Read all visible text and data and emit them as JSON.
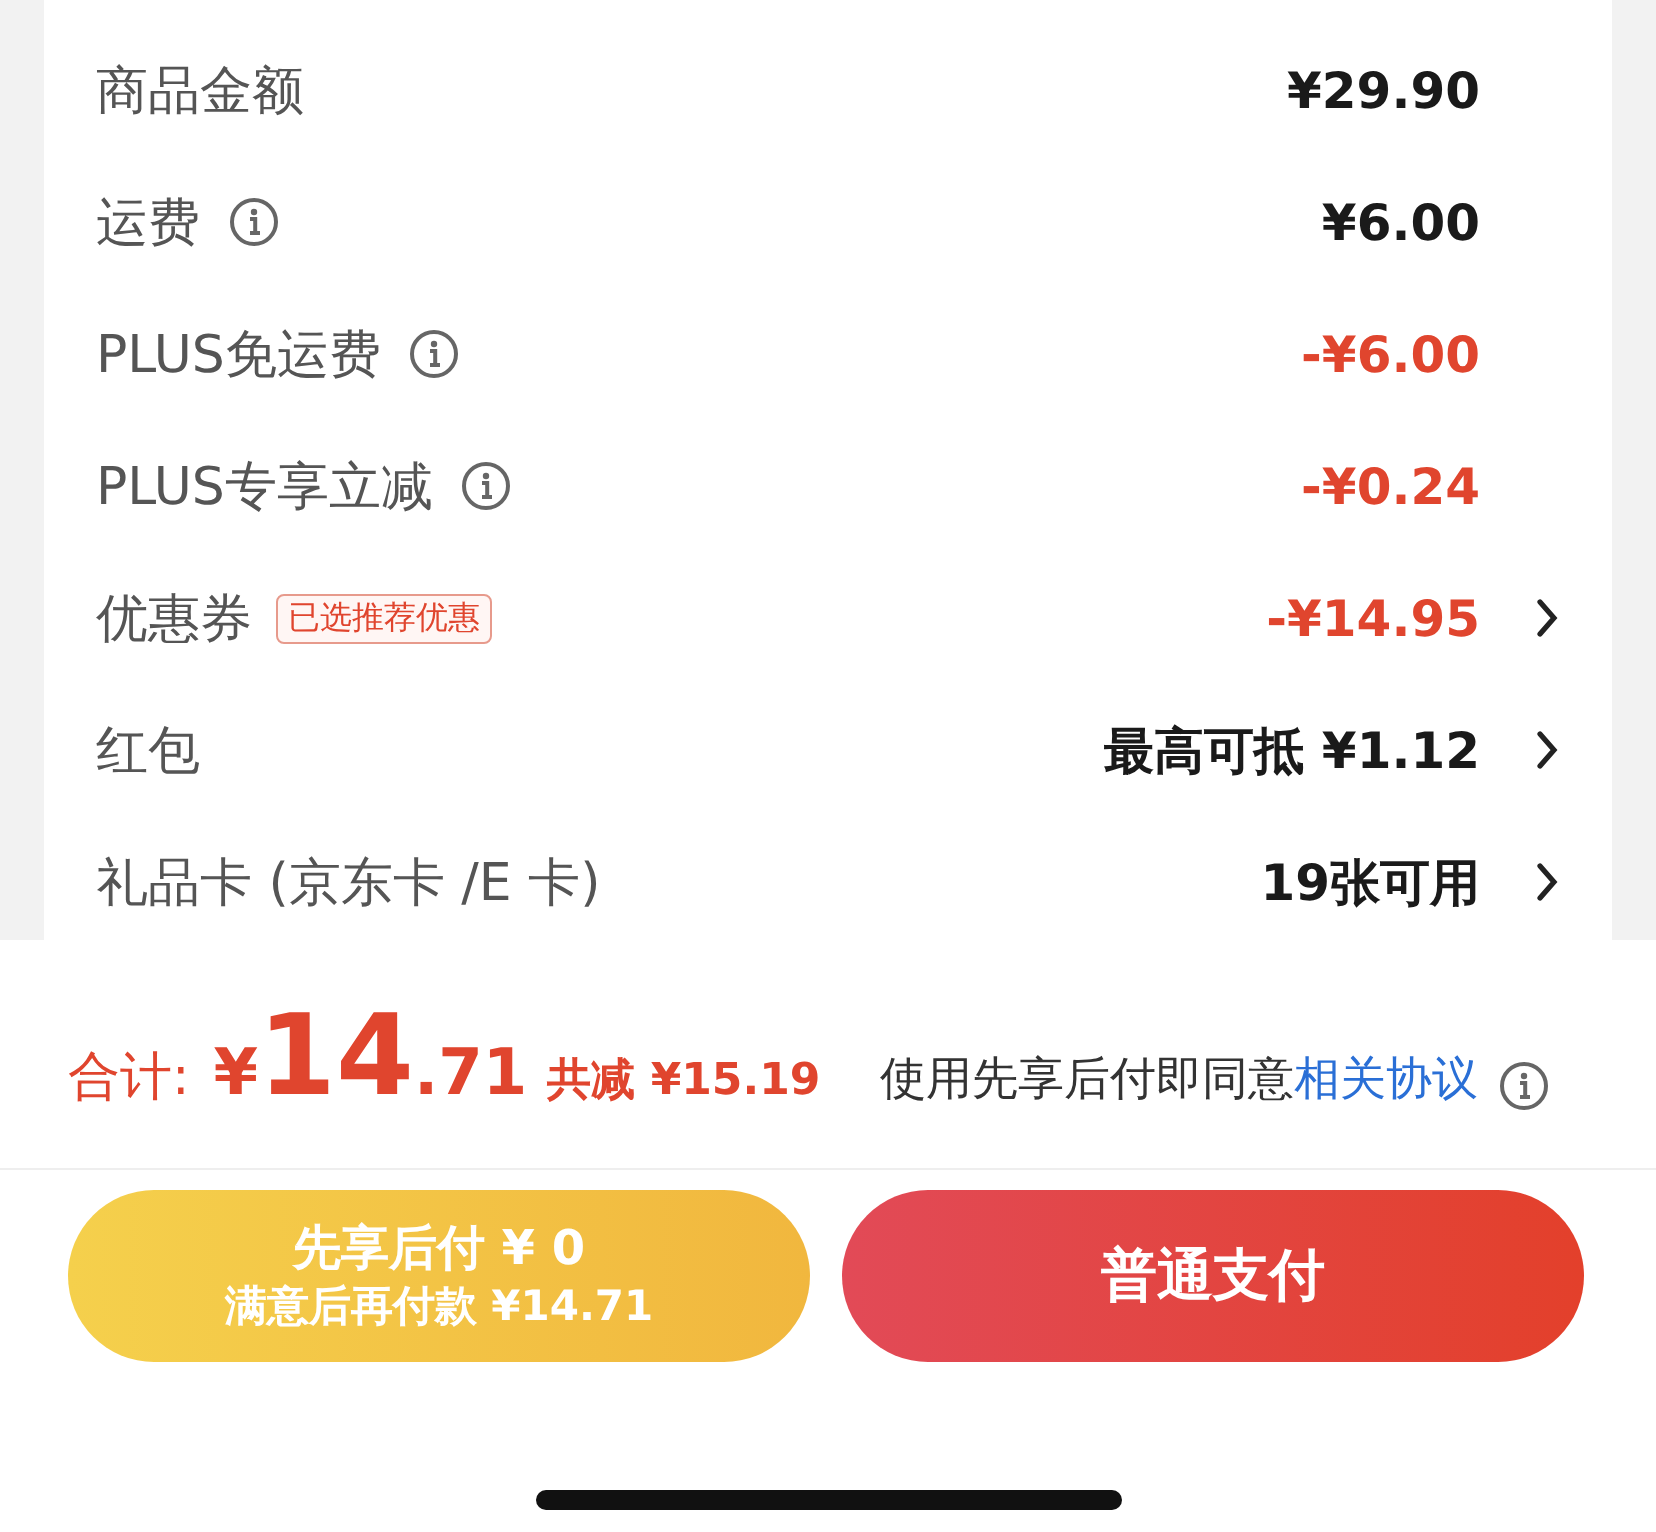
{
  "summary": {
    "rows": [
      {
        "label": "商品金额",
        "info": false,
        "value": "¥29.90",
        "kind": "amount",
        "chevron": false
      },
      {
        "label": "运费",
        "info": true,
        "value": "¥6.00",
        "kind": "amount",
        "chevron": false
      },
      {
        "label": "PLUS免运费",
        "info": true,
        "value": "-¥6.00",
        "kind": "discount",
        "chevron": false
      },
      {
        "label": "PLUS专享立减",
        "info": true,
        "value": "-¥0.24",
        "kind": "discount",
        "chevron": false
      },
      {
        "label": "优惠券",
        "info": false,
        "tag": "已选推荐优惠",
        "value": "-¥14.95",
        "kind": "discount",
        "chevron": true
      },
      {
        "label": "红包",
        "info": false,
        "value": "最高可抵 ¥1.12",
        "kind": "amount",
        "chevron": true
      },
      {
        "label": "礼品卡 (京东卡 /E 卡)",
        "info": false,
        "value": "19张可用",
        "kind": "amount",
        "chevron": true
      }
    ]
  },
  "total": {
    "label": "合计:",
    "currency": "¥",
    "integer": "14",
    "decimal": ".71",
    "saved": "共减 ¥15.19"
  },
  "agreement": {
    "text": "使用先享后付即同意",
    "link": "相关协议"
  },
  "buttons": {
    "bnpl": {
      "line1": "先享后付 ¥ 0",
      "line2": "满意后再付款 ¥14.71"
    },
    "pay": "普通支付"
  }
}
